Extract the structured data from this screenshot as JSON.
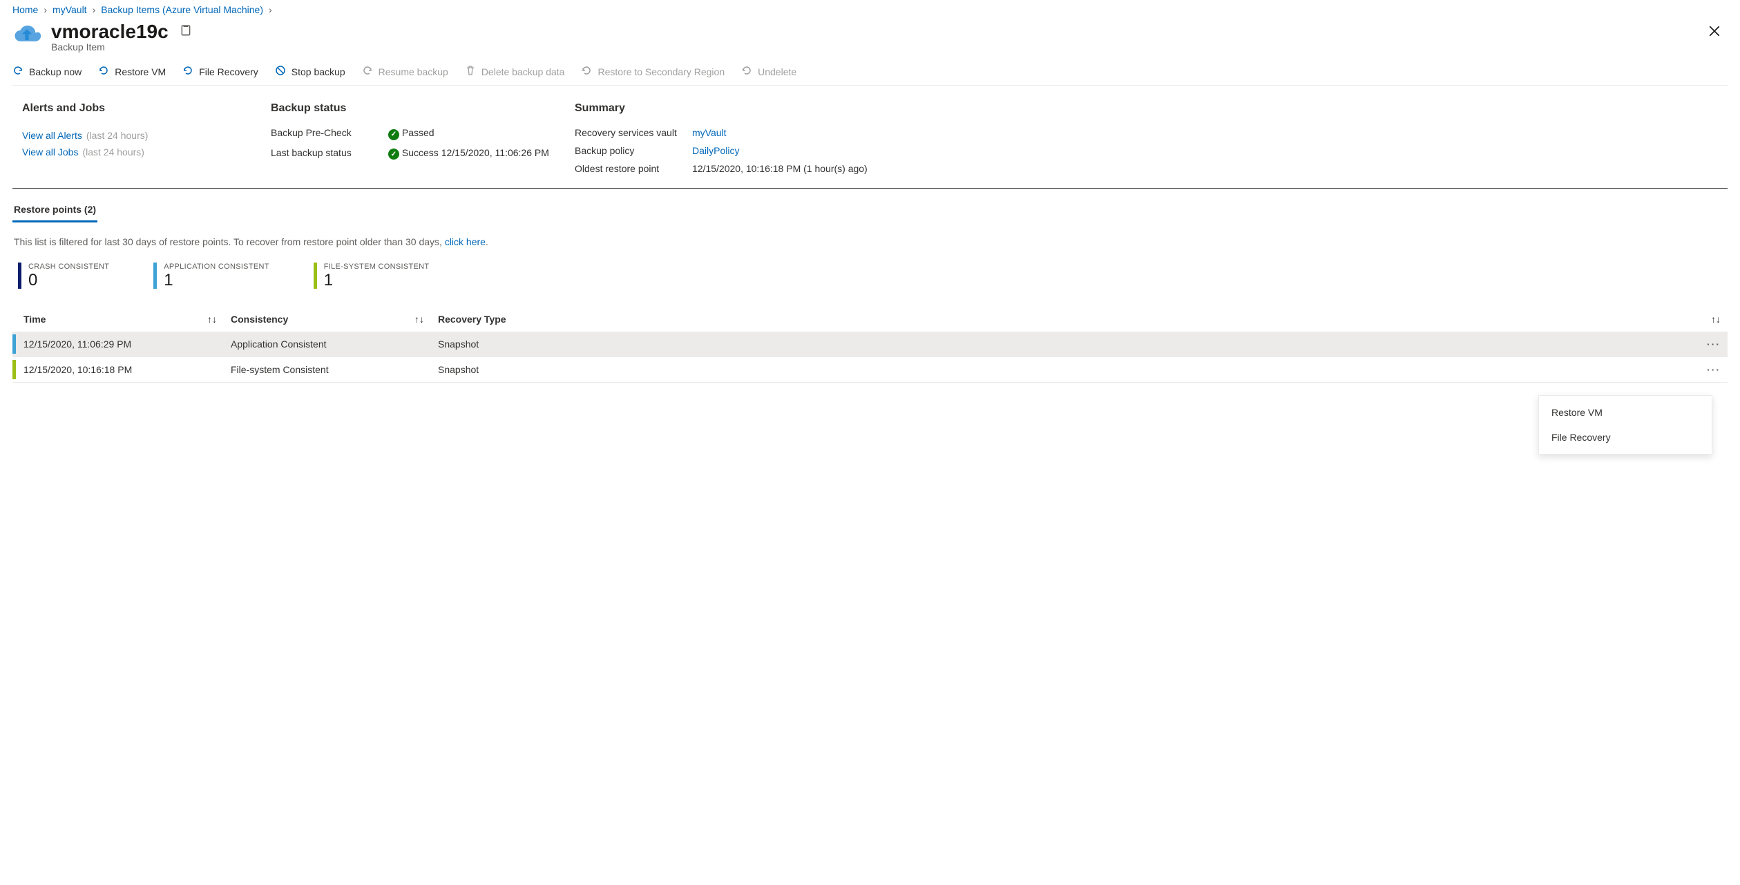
{
  "breadcrumb": {
    "home": "Home",
    "vault": "myVault",
    "items": "Backup Items (Azure Virtual Machine)"
  },
  "header": {
    "title": "vmoracle19c",
    "subtitle": "Backup Item"
  },
  "toolbar": {
    "backup_now": "Backup now",
    "restore_vm": "Restore VM",
    "file_recovery": "File Recovery",
    "stop_backup": "Stop backup",
    "resume_backup": "Resume backup",
    "delete_backup_data": "Delete backup data",
    "restore_secondary": "Restore to Secondary Region",
    "undelete": "Undelete"
  },
  "alerts": {
    "title": "Alerts and Jobs",
    "view_alerts": "View all Alerts",
    "view_jobs": "View all Jobs",
    "window": "(last 24 hours)"
  },
  "backup_status": {
    "title": "Backup status",
    "precheck_label": "Backup Pre-Check",
    "precheck_value": "Passed",
    "last_label": "Last backup status",
    "last_value": "Success 12/15/2020, 11:06:26 PM"
  },
  "summary": {
    "title": "Summary",
    "vault_label": "Recovery services vault",
    "vault_value": "myVault",
    "policy_label": "Backup policy",
    "policy_value": "DailyPolicy",
    "oldest_label": "Oldest restore point",
    "oldest_value": "12/15/2020, 10:16:18 PM (1 hour(s) ago)"
  },
  "restore": {
    "tab_label": "Restore points (2)",
    "filter_note_prefix": "This list is filtered for last 30 days of restore points. To recover from restore point older than 30 days, ",
    "filter_note_link": "click here",
    "filter_note_suffix": ".",
    "counters": {
      "crash_label": "CRASH CONSISTENT",
      "crash_value": "0",
      "crash_color": "#0b1d6b",
      "app_label": "APPLICATION CONSISTENT",
      "app_value": "1",
      "app_color": "#3ea2d6",
      "fs_label": "FILE-SYSTEM CONSISTENT",
      "fs_value": "1",
      "fs_color": "#9bbf16"
    },
    "columns": {
      "time": "Time",
      "consistency": "Consistency",
      "recovery": "Recovery Type"
    },
    "rows": [
      {
        "time": "12/15/2020, 11:06:29 PM",
        "consistency": "Application Consistent",
        "recovery": "Snapshot",
        "color": "#3ea2d6",
        "selected": true
      },
      {
        "time": "12/15/2020, 10:16:18 PM",
        "consistency": "File-system Consistent",
        "recovery": "Snapshot",
        "color": "#9bbf16",
        "selected": false
      }
    ]
  },
  "ctx": {
    "restore_vm": "Restore VM",
    "file_recovery": "File Recovery"
  }
}
